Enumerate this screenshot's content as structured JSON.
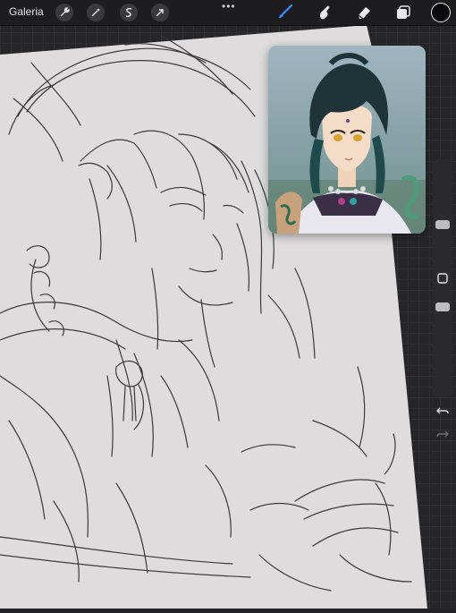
{
  "topbar": {
    "gallery_label": "Galeria",
    "actions_icon": "wrench-icon",
    "adjustments_icon": "magic-wand-icon",
    "selection_icon": "selection-s-icon",
    "transform_icon": "arrow-cursor-icon",
    "more_dots": "•••",
    "brush_icon": "brush-icon",
    "smudge_icon": "smudge-finger-icon",
    "eraser_icon": "eraser-icon",
    "layers_icon": "layers-icon",
    "brush_active_color": "#2f8cff",
    "current_color": "#0b0b0b"
  },
  "sidebar": {
    "brush_size_level": 0.28,
    "opacity_level": 0.62,
    "modifier_icon": "square-modifier-icon",
    "undo_icon": "undo-icon",
    "redo_icon": "redo-icon"
  }
}
